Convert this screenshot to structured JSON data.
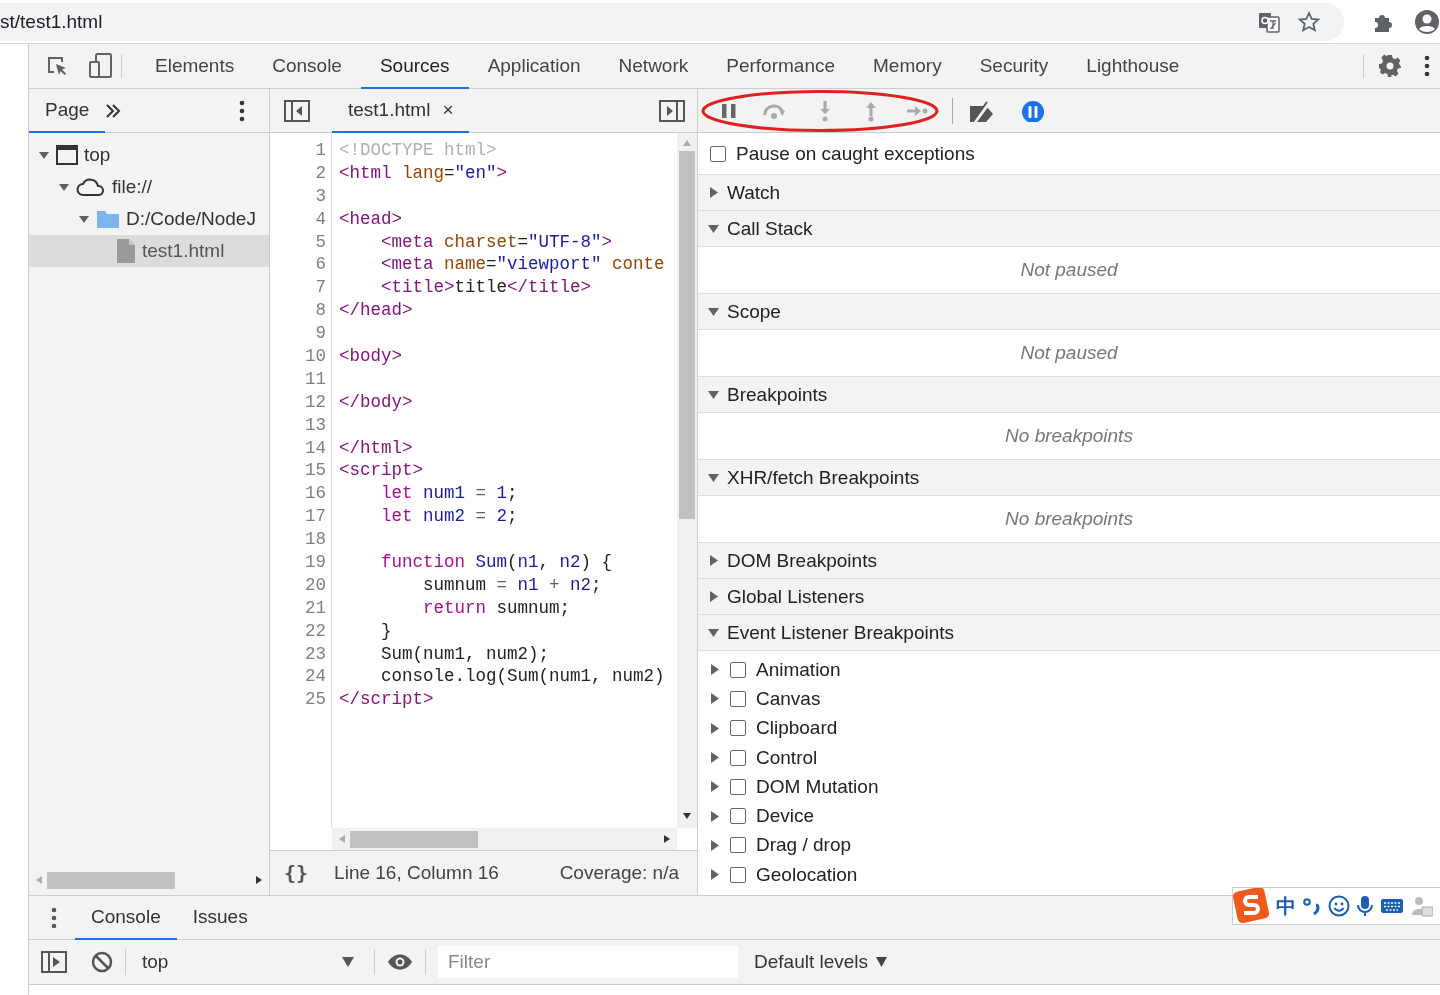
{
  "address_bar": {
    "url": "st/test1.html"
  },
  "main_tabs": [
    {
      "label": "Elements",
      "selected": false
    },
    {
      "label": "Console",
      "selected": false
    },
    {
      "label": "Sources",
      "selected": true
    },
    {
      "label": "Application",
      "selected": false
    },
    {
      "label": "Network",
      "selected": false
    },
    {
      "label": "Performance",
      "selected": false
    },
    {
      "label": "Memory",
      "selected": false
    },
    {
      "label": "Security",
      "selected": false
    },
    {
      "label": "Lighthouse",
      "selected": false
    }
  ],
  "navigator": {
    "tabs": [
      {
        "label": "Page",
        "selected": true
      }
    ],
    "tree": [
      {
        "label": "top",
        "kind": "frame",
        "expanded": true,
        "selected": false,
        "children": [
          {
            "label": "file://",
            "kind": "origin",
            "expanded": true,
            "selected": false,
            "children": [
              {
                "label": "D:/Code/NodeJ",
                "kind": "folder",
                "expanded": true,
                "selected": false,
                "children": [
                  {
                    "label": "test1.html",
                    "kind": "file",
                    "selected": true
                  }
                ]
              }
            ]
          }
        ]
      }
    ]
  },
  "editor": {
    "tabs": [
      {
        "label": "test1.html",
        "selected": true,
        "close": "×"
      }
    ],
    "lines": [
      {
        "number": "1",
        "tokens": [
          {
            "kind": "meta",
            "text": "<!DOCTYPE html>"
          }
        ]
      },
      {
        "number": "2",
        "tokens": [
          {
            "kind": "tag",
            "text": "<html"
          },
          {
            "kind": "attr",
            "text": " lang"
          },
          {
            "kind": "plain",
            "text": "="
          },
          {
            "kind": "string",
            "text": "\"en\""
          },
          {
            "kind": "tag",
            "text": ">"
          }
        ]
      },
      {
        "number": "3"
      },
      {
        "number": "4",
        "tokens": [
          {
            "kind": "tag",
            "text": "<head>"
          }
        ]
      },
      {
        "number": "5",
        "tokens": [
          {
            "kind": "tag",
            "text": "    <meta"
          },
          {
            "kind": "attr",
            "text": " charset"
          },
          {
            "kind": "plain",
            "text": "="
          },
          {
            "kind": "string",
            "text": "\"UTF-8\""
          },
          {
            "kind": "tag",
            "text": ">"
          }
        ]
      },
      {
        "number": "6",
        "tokens": [
          {
            "kind": "tag",
            "text": "    <meta"
          },
          {
            "kind": "attr",
            "text": " name"
          },
          {
            "kind": "plain",
            "text": "="
          },
          {
            "kind": "string",
            "text": "\"viewport\""
          },
          {
            "kind": "attr",
            "text": " conte"
          }
        ]
      },
      {
        "number": "7",
        "tokens": [
          {
            "kind": "tag",
            "text": "    <title>"
          },
          {
            "kind": "plain",
            "text": "title"
          },
          {
            "kind": "tag",
            "text": "</title>"
          }
        ]
      },
      {
        "number": "8",
        "tokens": [
          {
            "kind": "tag",
            "text": "</head>"
          }
        ]
      },
      {
        "number": "9"
      },
      {
        "number": "10",
        "tokens": [
          {
            "kind": "tag",
            "text": "<body>"
          }
        ]
      },
      {
        "number": "11"
      },
      {
        "number": "12",
        "tokens": [
          {
            "kind": "tag",
            "text": "</body>"
          }
        ]
      },
      {
        "number": "13"
      },
      {
        "number": "14",
        "tokens": [
          {
            "kind": "tag",
            "text": "</html>"
          }
        ]
      },
      {
        "number": "15",
        "tokens": [
          {
            "kind": "tag",
            "text": "<script>"
          }
        ]
      },
      {
        "number": "16",
        "tokens": [
          {
            "kind": "keyword",
            "text": "    let"
          },
          {
            "kind": "def",
            "text": " num1"
          },
          {
            "kind": "operator",
            "text": " ="
          },
          {
            "kind": "number",
            "text": " 1"
          },
          {
            "kind": "plain",
            "text": ";"
          }
        ]
      },
      {
        "number": "17",
        "tokens": [
          {
            "kind": "keyword",
            "text": "    let"
          },
          {
            "kind": "def",
            "text": " num2"
          },
          {
            "kind": "operator",
            "text": " ="
          },
          {
            "kind": "number",
            "text": " 2"
          },
          {
            "kind": "plain",
            "text": ";"
          }
        ]
      },
      {
        "number": "18"
      },
      {
        "number": "19",
        "tokens": [
          {
            "kind": "keyword",
            "text": "    function"
          },
          {
            "kind": "def",
            "text": " Sum"
          },
          {
            "kind": "plain",
            "text": "("
          },
          {
            "kind": "def",
            "text": "n1"
          },
          {
            "kind": "plain",
            "text": ", "
          },
          {
            "kind": "def",
            "text": "n2"
          },
          {
            "kind": "plain",
            "text": ") {"
          }
        ]
      },
      {
        "number": "20",
        "tokens": [
          {
            "kind": "plain",
            "text": "        sumnum "
          },
          {
            "kind": "operator",
            "text": "="
          },
          {
            "kind": "def",
            "text": " n1"
          },
          {
            "kind": "operator",
            "text": " +"
          },
          {
            "kind": "def",
            "text": " n2"
          },
          {
            "kind": "plain",
            "text": ";"
          }
        ]
      },
      {
        "number": "21",
        "tokens": [
          {
            "kind": "keyword",
            "text": "        return"
          },
          {
            "kind": "plain",
            "text": " sumnum;"
          }
        ]
      },
      {
        "number": "22",
        "tokens": [
          {
            "kind": "plain",
            "text": "    }"
          }
        ]
      },
      {
        "number": "23",
        "tokens": [
          {
            "kind": "plain",
            "text": "    Sum(num1, num2);"
          }
        ]
      },
      {
        "number": "24",
        "tokens": [
          {
            "kind": "plain",
            "text": "    console.log(Sum(num1, num2)"
          }
        ]
      },
      {
        "number": "25",
        "tokens": [
          {
            "kind": "tag",
            "text": "</script>"
          }
        ]
      }
    ],
    "status": {
      "format": "{}",
      "position": "Line 16, Column 16",
      "coverage": "Coverage: n/a"
    }
  },
  "debugger": {
    "pause_on_caught": {
      "label": "Pause on caught exceptions",
      "checked": false
    },
    "sections": [
      {
        "title": "Watch",
        "expanded": false
      },
      {
        "title": "Call Stack",
        "expanded": true,
        "message": "Not paused"
      },
      {
        "title": "Scope",
        "expanded": true,
        "message": "Not paused"
      },
      {
        "title": "Breakpoints",
        "expanded": true,
        "message": "No breakpoints"
      },
      {
        "title": "XHR/fetch Breakpoints",
        "expanded": true,
        "message": "No breakpoints"
      },
      {
        "title": "DOM Breakpoints",
        "expanded": false
      },
      {
        "title": "Global Listeners",
        "expanded": false
      },
      {
        "title": "Event Listener Breakpoints",
        "expanded": true,
        "items": [
          {
            "label": "Animation",
            "checked": false
          },
          {
            "label": "Canvas",
            "checked": false
          },
          {
            "label": "Clipboard",
            "checked": false
          },
          {
            "label": "Control",
            "checked": false
          },
          {
            "label": "DOM Mutation",
            "checked": false
          },
          {
            "label": "Device",
            "checked": false
          },
          {
            "label": "Drag / drop",
            "checked": false
          },
          {
            "label": "Geolocation",
            "checked": false
          }
        ]
      }
    ]
  },
  "drawer": {
    "tabs": [
      {
        "label": "Console",
        "selected": true
      },
      {
        "label": "Issues",
        "selected": false
      }
    ],
    "context": "top",
    "filter": {
      "placeholder": "Filter"
    },
    "levels": "Default levels"
  },
  "ime_toolbar": {
    "mode": "中"
  }
}
